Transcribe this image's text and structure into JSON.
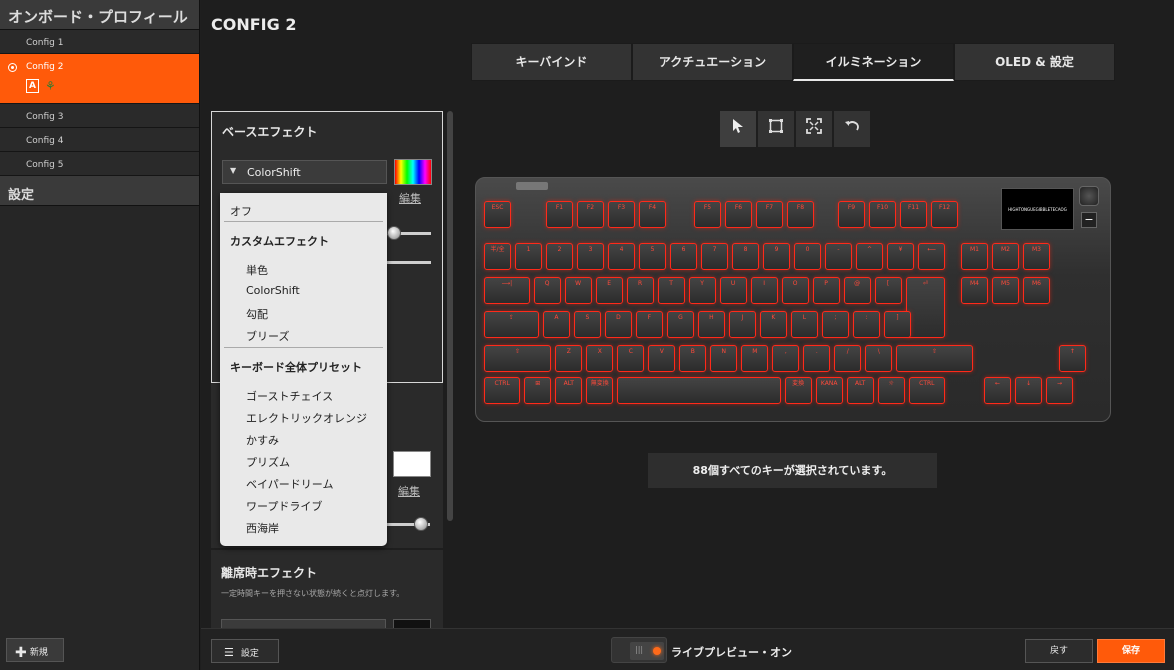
{
  "sidebar": {
    "header": "オンボード・プロフィール",
    "profiles": [
      "Config 1",
      "Config 2",
      "Config 3",
      "Config 4",
      "Config 5"
    ],
    "active_profile": "Config 2",
    "active_badges": {
      "a": "A",
      "b": "⚘"
    },
    "settings_label": "設定",
    "new_label": "新規"
  },
  "header": {
    "title": "CONFIG 2"
  },
  "tabs": [
    {
      "label": "キーバインド"
    },
    {
      "label": "アクチュエーション"
    },
    {
      "label": "イルミネーション"
    },
    {
      "label": "OLED & 設定"
    }
  ],
  "active_tab": "イルミネーション",
  "base_effect": {
    "title": "ベースエフェクト",
    "selected": "ColorShift",
    "edit_label": "編集",
    "edit_label_2": "編集"
  },
  "effect_menu": {
    "off": "オフ",
    "custom_header": "カスタムエフェクト",
    "custom_items": [
      "単色",
      "ColorShift",
      "勾配",
      "ブリーズ"
    ],
    "preset_header": "キーボード全体プリセット",
    "preset_items": [
      "ゴーストチェイス",
      "エレクトリックオレンジ",
      "かすみ",
      "プリズム",
      "ベイパードリーム",
      "ワープドライブ",
      "西海岸"
    ]
  },
  "idle_effect": {
    "title": "離席時エフェクト",
    "description": "一定時間キーを押さない状態が続くと点灯します。"
  },
  "tools": {
    "select_icon": "cursor-icon",
    "rect_select_icon": "rect-select-icon",
    "select_all_icon": "expand-icon",
    "undo_icon": "undo-icon"
  },
  "keyboard": {
    "oled_text": "HIGHTONGUEGIBBLETECAOG",
    "rows": [
      [
        "ESC",
        "F1",
        "F2",
        "F3",
        "F4",
        "F5",
        "F6",
        "F7",
        "F8",
        "F9",
        "F10",
        "F11",
        "F12"
      ],
      [
        "半/全",
        "1",
        "2",
        "3",
        "4",
        "5",
        "6",
        "7",
        "8",
        "9",
        "0",
        "-",
        "^",
        "¥",
        "⟵",
        "M1",
        "M2",
        "M3"
      ],
      [
        "⟶|",
        "Q",
        "W",
        "E",
        "R",
        "T",
        "Y",
        "U",
        "I",
        "O",
        "P",
        "@",
        "[",
        "⏎",
        "M4",
        "M5",
        "M6"
      ],
      [
        "⇪",
        "A",
        "S",
        "D",
        "F",
        "G",
        "H",
        "J",
        "K",
        "L",
        ";",
        ":",
        "]"
      ],
      [
        "⇧",
        "Z",
        "X",
        "C",
        "V",
        "B",
        "N",
        "M",
        ",",
        ".",
        "/",
        "\\",
        "⇧",
        "↑"
      ],
      [
        "CTRL",
        "⊞",
        "ALT",
        "無変換",
        "",
        "変換",
        "KANA",
        "ALT",
        "☼",
        "CTRL",
        "←",
        "↓",
        "→"
      ]
    ]
  },
  "status": {
    "selection_message": "88個すべてのキーが選択されています。"
  },
  "bottom": {
    "settings_label": "設定",
    "live_preview": "ライブプレビュー・オン",
    "back_label": "戻す",
    "save_label": "保存"
  },
  "colors": {
    "accent": "#ff5a0a",
    "key_glow": "#ff2a1a"
  }
}
